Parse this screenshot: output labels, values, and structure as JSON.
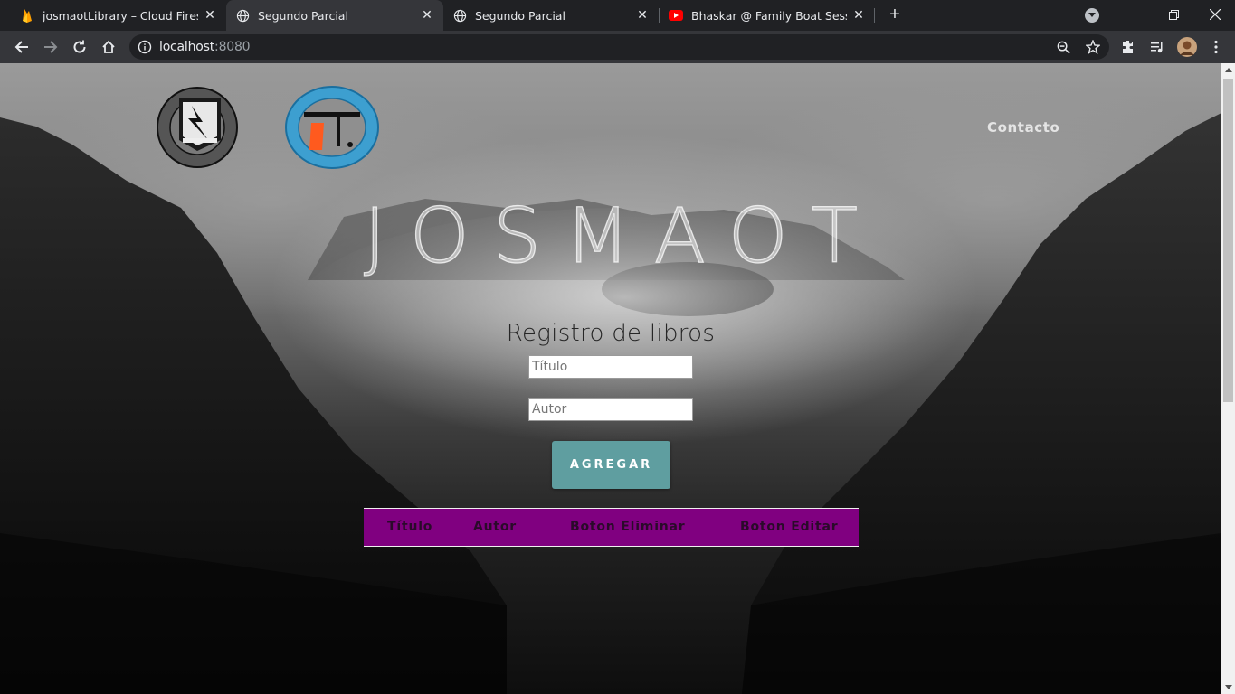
{
  "browser": {
    "tabs": [
      {
        "title": "josmaotLibrary – Cloud Firestore",
        "icon": "firebase-icon",
        "active": false
      },
      {
        "title": "Segundo Parcial",
        "icon": "globe-icon",
        "active": true
      },
      {
        "title": "Segundo Parcial",
        "icon": "globe-icon",
        "active": false
      },
      {
        "title": "Bhaskar @ Family Boat Session -",
        "icon": "youtube-icon",
        "active": false
      }
    ],
    "url_host": "localhost",
    "url_port": ":8080",
    "colors": {
      "chrome_dark": "#202124",
      "chrome_toolbar": "#35363a"
    }
  },
  "page": {
    "nav": {
      "contact_label": "Contacto"
    },
    "brand": "JOSMAOT",
    "form": {
      "title": "Registro de libros",
      "title_placeholder": "Título",
      "author_placeholder": "Autor",
      "add_label": "AGREGAR"
    },
    "table": {
      "headers": [
        "Título",
        "Autor",
        "Boton Eliminar",
        "Boton Editar"
      ]
    },
    "colors": {
      "button": "#5f9ea0",
      "table_header": "#800080"
    }
  }
}
